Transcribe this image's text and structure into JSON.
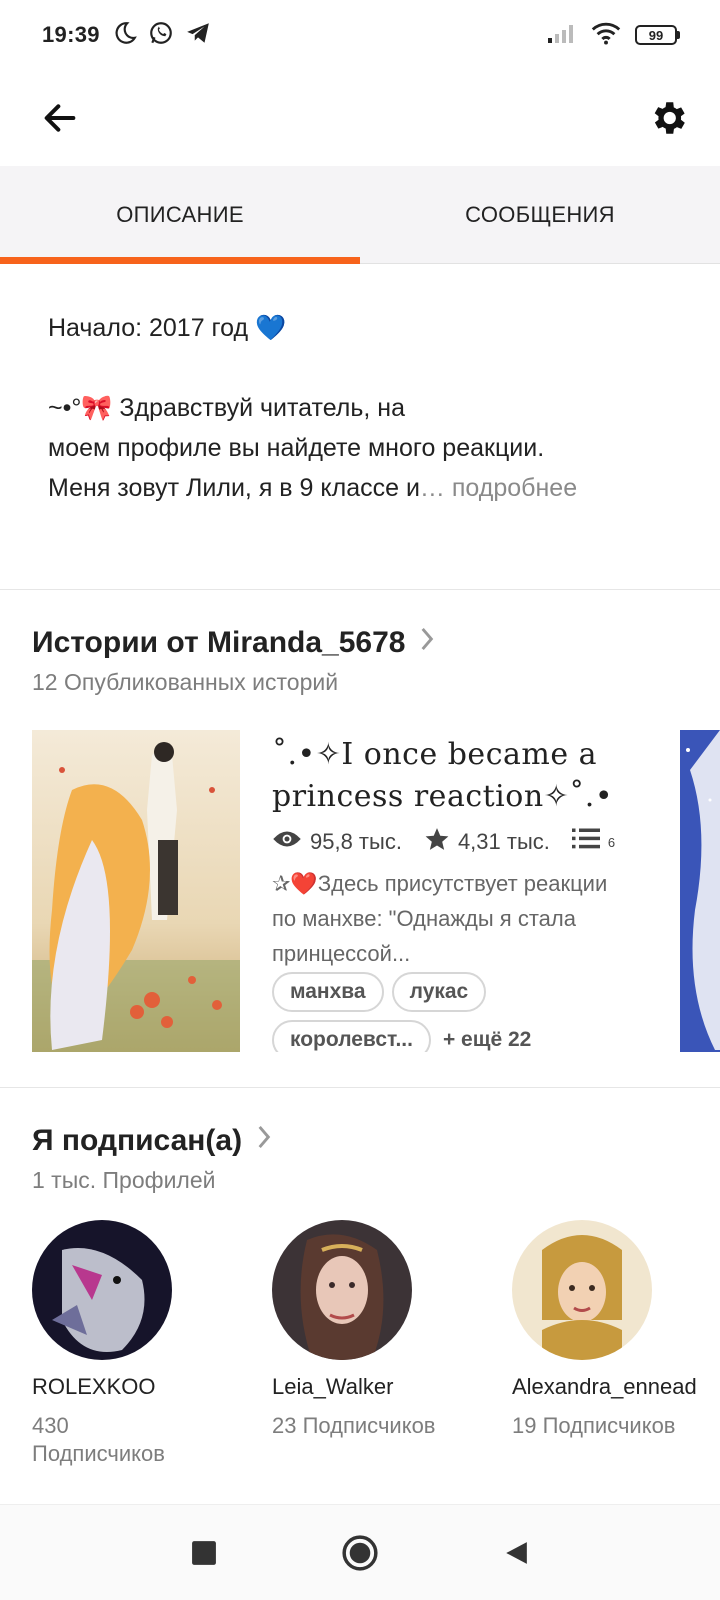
{
  "status_bar": {
    "time": "19:39",
    "battery": "99",
    "left_icons": [
      "moon-icon",
      "whatsapp-icon",
      "telegram-icon"
    ],
    "right_icons": [
      "signal-icon",
      "wifi-icon",
      "battery-icon"
    ]
  },
  "header": {
    "back_icon": "back-arrow-icon",
    "settings_icon": "gear-icon"
  },
  "tabs": [
    {
      "label": "ОПИСАНИЕ",
      "active": true
    },
    {
      "label": "СООБЩЕНИЯ",
      "active": false
    }
  ],
  "description": {
    "line1": "Начало: 2017 год 💙",
    "line2": "~•°🎀 Здравствуй читатель, на",
    "line3": "моем профиле вы найдете много реакции.",
    "line4": "Меня зовут Лили, я в 9 классе и",
    "ellipsis": "… ",
    "more": "подробнее"
  },
  "stories": {
    "title": "Истории от Miranda_5678",
    "subtitle": "12 Опубликованных историй",
    "card": {
      "title": "˚.•✧I once became a princess reaction✧˚.•",
      "views": "95,8 тыс.",
      "votes": "4,31 тыс.",
      "parts": "6",
      "description": "✰❤️Здесь присутствует реакции по манхве: \"Однажды я стала принцессой...",
      "tags": [
        "манхва",
        "лукас",
        "королевст..."
      ],
      "more_tags": "+ ещё 22"
    }
  },
  "following": {
    "title": "Я подписан(а)",
    "subtitle": "1 тыс. Профилей",
    "profiles": [
      {
        "name": "ROLEXKOO",
        "followers_line1": "430",
        "followers_line2": "Подписчиков"
      },
      {
        "name": "Leia_Walker",
        "followers_line1": "23 Подписчиков",
        "followers_line2": ""
      },
      {
        "name": "Alexandra_ennead",
        "followers_line1": "19 Подписчиков",
        "followers_line2": ""
      }
    ]
  },
  "nav": {
    "icons": [
      "recent-apps-icon",
      "home-icon",
      "back-icon"
    ]
  },
  "colors": {
    "accent": "#f7631b",
    "tab_bg": "#f5f4f6",
    "muted_text": "#7d7d7d"
  }
}
